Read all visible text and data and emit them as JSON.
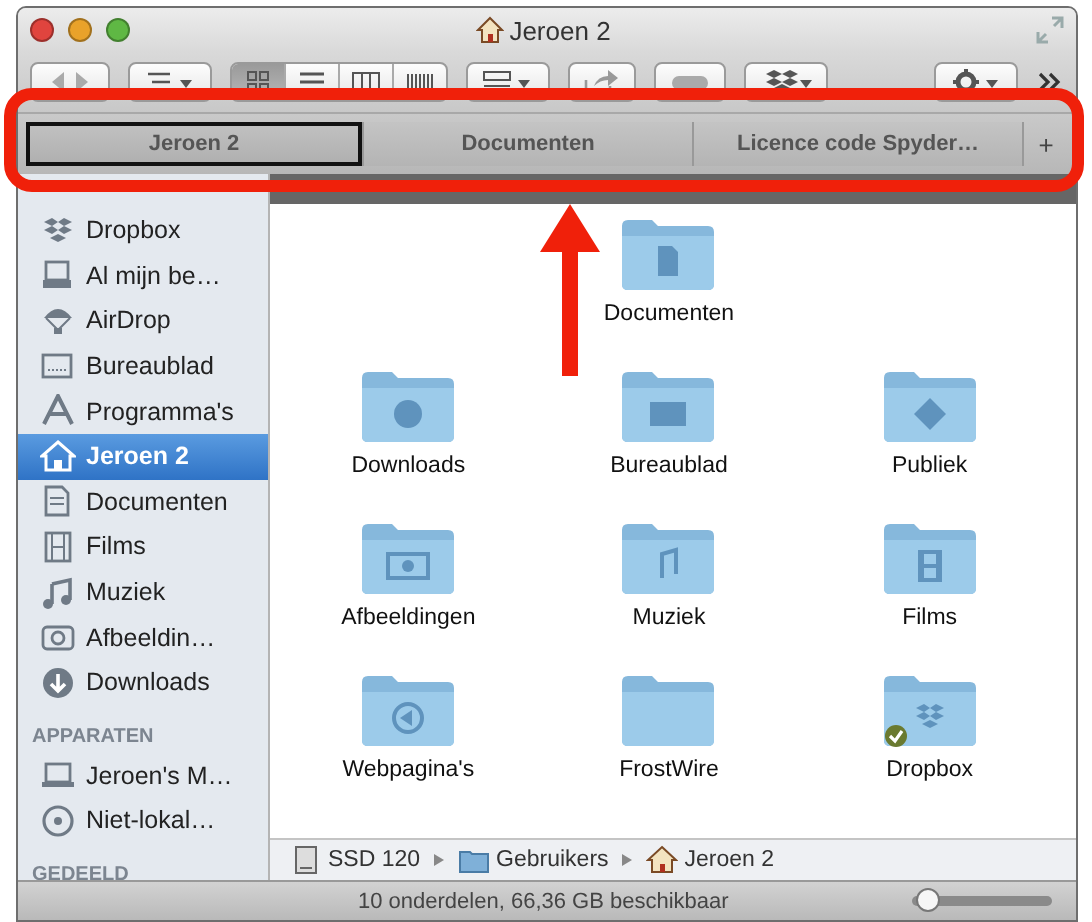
{
  "window": {
    "title": "Jeroen 2"
  },
  "toolbar": {
    "view_modes": [
      {
        "kind": "icons",
        "selected": true
      },
      {
        "kind": "list",
        "selected": false
      },
      {
        "kind": "columns",
        "selected": false
      },
      {
        "kind": "coverflow",
        "selected": false
      }
    ]
  },
  "tabs": [
    {
      "label": "Jeroen 2",
      "selected": true
    },
    {
      "label": "Documenten",
      "selected": false
    },
    {
      "label": "Licence code Spyder…",
      "selected": false
    }
  ],
  "new_tab": "+",
  "sidebar": {
    "sections": [
      {
        "items": [
          {
            "label": "Dropbox",
            "kind": "dropbox",
            "selected": false
          },
          {
            "label": "Al mijn be…",
            "kind": "allfiles",
            "selected": false
          },
          {
            "label": "AirDrop",
            "kind": "airdrop",
            "selected": false
          },
          {
            "label": "Bureaublad",
            "kind": "desktop",
            "selected": false
          },
          {
            "label": "Programma's",
            "kind": "apps",
            "selected": false
          },
          {
            "label": "Jeroen 2",
            "kind": "home",
            "selected": true
          },
          {
            "label": "Documenten",
            "kind": "documents",
            "selected": false
          },
          {
            "label": "Films",
            "kind": "movies",
            "selected": false
          },
          {
            "label": "Muziek",
            "kind": "music",
            "selected": false
          },
          {
            "label": "Afbeeldin…",
            "kind": "pictures",
            "selected": false
          },
          {
            "label": "Downloads",
            "kind": "downloads",
            "selected": false
          }
        ]
      },
      {
        "header": "APPARATEN",
        "items": [
          {
            "label": "Jeroen's M…",
            "kind": "laptop",
            "selected": false
          },
          {
            "label": "Niet-lokal…",
            "kind": "disc",
            "selected": false
          }
        ]
      },
      {
        "header": "GEDEELD"
      }
    ]
  },
  "files": [
    {
      "label": "Documenten",
      "kind": "documents"
    },
    {
      "label": "Downloads",
      "kind": "downloads"
    },
    {
      "label": "Bureaublad",
      "kind": "desktop"
    },
    {
      "label": "Publiek",
      "kind": "public"
    },
    {
      "label": "Afbeeldingen",
      "kind": "pictures"
    },
    {
      "label": "Muziek",
      "kind": "music"
    },
    {
      "label": "Films",
      "kind": "movies"
    },
    {
      "label": "Webpagina's",
      "kind": "sites"
    },
    {
      "label": "FrostWire",
      "kind": "plain"
    },
    {
      "label": "Dropbox",
      "kind": "dropbox"
    }
  ],
  "path_bar": [
    {
      "label": "SSD 120",
      "kind": "drive"
    },
    {
      "label": "Gebruikers",
      "kind": "folder"
    },
    {
      "label": "Jeroen 2",
      "kind": "home"
    }
  ],
  "status_bar": {
    "text": "10 onderdelen, 66,36 GB beschikbaar",
    "zoom": {
      "level": 0.12
    }
  }
}
